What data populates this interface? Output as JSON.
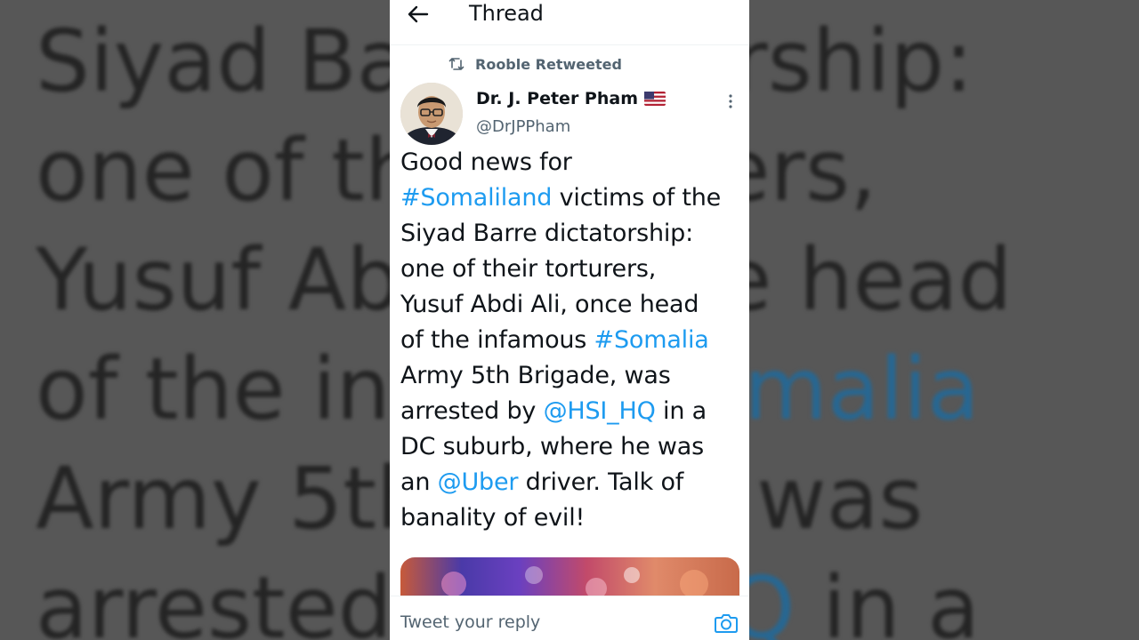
{
  "background_text": {
    "lines": [
      [
        "Siyad Ba",
        "",
        "orship:"
      ],
      [
        "one of th",
        "",
        "ers,"
      ],
      [
        "Yusuf Ab",
        "",
        "ce head"
      ],
      [
        "of the inf",
        "",
        ""
      ],
      [
        "Army 5th",
        "",
        "was"
      ],
      [
        "arrested",
        "",
        "HQ in a"
      ]
    ],
    "tag_overlay": "Somalia"
  },
  "header": {
    "title": "Thread",
    "back_icon": "arrow-left-icon"
  },
  "retweet": {
    "icon": "retweet-icon",
    "label": "Rooble Retweeted"
  },
  "author": {
    "name": "Dr. J. Peter Pham",
    "flag_icon": "us-flag-icon",
    "handle": "@DrJPPham"
  },
  "tweet": {
    "lines": [
      [
        {
          "t": "Good news for",
          "link": false
        }
      ],
      [
        {
          "t": "#Somaliland",
          "link": true
        },
        {
          "t": " victims of the",
          "link": false
        }
      ],
      [
        {
          "t": "Siyad Barre dictatorship:",
          "link": false
        }
      ],
      [
        {
          "t": "one of their torturers,",
          "link": false
        }
      ],
      [
        {
          "t": "Yusuf Abdi Ali, once head",
          "link": false
        }
      ],
      [
        {
          "t": "of the infamous ",
          "link": false
        },
        {
          "t": "#Somalia",
          "link": true
        }
      ],
      [
        {
          "t": "Army 5th Brigade, was",
          "link": false
        }
      ],
      [
        {
          "t": "arrested by ",
          "link": false
        },
        {
          "t": "@HSI_HQ",
          "link": true
        },
        {
          "t": " in a",
          "link": false
        }
      ],
      [
        {
          "t": "DC suburb, where he was",
          "link": false
        }
      ],
      [
        {
          "t": "an ",
          "link": false
        },
        {
          "t": "@Uber",
          "link": true
        },
        {
          "t": " driver. Talk of",
          "link": false
        }
      ],
      [
        {
          "t": "banality of evil!",
          "link": false
        }
      ]
    ]
  },
  "reply": {
    "placeholder": "Tweet your reply",
    "camera_icon": "camera-icon"
  },
  "colors": {
    "link": "#1d9bf0",
    "text": "#0f1419",
    "secondary": "#536471"
  }
}
